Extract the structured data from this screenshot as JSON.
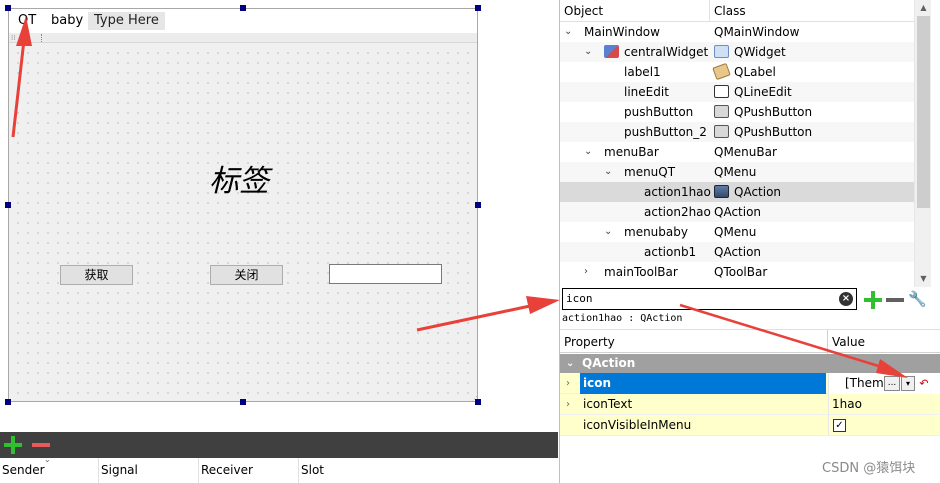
{
  "form": {
    "menubar": {
      "items": [
        "QT",
        "baby"
      ],
      "type_here": "Type Here"
    },
    "label1_text": "标签",
    "button_get": "获取",
    "button_close": "关闭",
    "line_edit_value": ""
  },
  "signal_slot": {
    "columns": [
      "Sender",
      "Signal",
      "Receiver",
      "Slot"
    ]
  },
  "object_inspector": {
    "headers": {
      "object": "Object",
      "class": "Class"
    },
    "rows": [
      {
        "object": "MainWindow",
        "class": "QMainWindow",
        "depth": 0,
        "expanded": true,
        "icon": ""
      },
      {
        "object": "centralWidget",
        "class": "QWidget",
        "depth": 1,
        "expanded": true,
        "icon": "widget-icon"
      },
      {
        "object": "label1",
        "class": "QLabel",
        "depth": 2,
        "icon": "label-icon"
      },
      {
        "object": "lineEdit",
        "class": "QLineEdit",
        "depth": 2,
        "icon": "line-edit-icon"
      },
      {
        "object": "pushButton",
        "class": "QPushButton",
        "depth": 2,
        "icon": "push-button-icon"
      },
      {
        "object": "pushButton_2",
        "class": "QPushButton",
        "depth": 2,
        "icon": "push-button-icon"
      },
      {
        "object": "menuBar",
        "class": "QMenuBar",
        "depth": 1,
        "expanded": true,
        "icon": ""
      },
      {
        "object": "menuQT",
        "class": "QMenu",
        "depth": 2,
        "expanded": true,
        "icon": ""
      },
      {
        "object": "action1hao",
        "class": "QAction",
        "depth": 3,
        "icon": "action-icon",
        "selected": true
      },
      {
        "object": "action2hao",
        "class": "QAction",
        "depth": 3,
        "icon": ""
      },
      {
        "object": "menubaby",
        "class": "QMenu",
        "depth": 2,
        "expanded": true,
        "icon": ""
      },
      {
        "object": "actionb1",
        "class": "QAction",
        "depth": 3,
        "icon": ""
      },
      {
        "object": "mainToolBar",
        "class": "QToolBar",
        "depth": 1,
        "expanded": false,
        "icon": ""
      }
    ]
  },
  "property_editor": {
    "filter_value": "icon",
    "object_class_label": "action1hao : QAction",
    "headers": {
      "property": "Property",
      "value": "Value"
    },
    "group": "QAction",
    "rows": [
      {
        "name": "icon",
        "value": "[Theme",
        "selected": true
      },
      {
        "name": "iconText",
        "value": "1hao"
      },
      {
        "name": "iconVisibleInMenu",
        "value": "checked"
      }
    ],
    "icon_dots": "...",
    "icon_drop": "▾",
    "icon_reset": "↶"
  },
  "watermark": "CSDN @猿饵块",
  "colors": {
    "accent": "#0078d7",
    "arrow": "#e8413a",
    "selection_handle": "#000080"
  }
}
